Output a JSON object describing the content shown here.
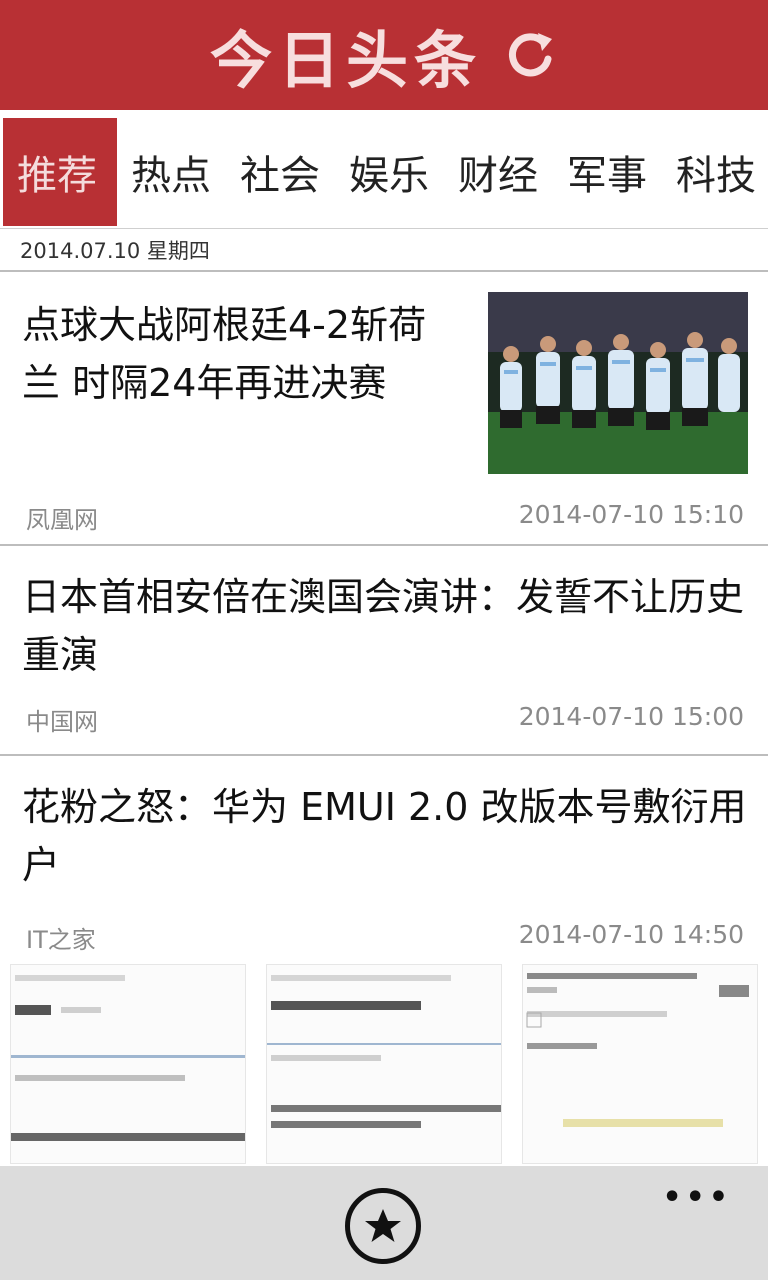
{
  "header": {
    "logo_text": "今日头条",
    "refresh_icon": "refresh-icon"
  },
  "tabs": [
    {
      "label": "推荐",
      "active": true
    },
    {
      "label": "热点"
    },
    {
      "label": "社会"
    },
    {
      "label": "娱乐"
    },
    {
      "label": "财经"
    },
    {
      "label": "军事"
    },
    {
      "label": "科技"
    }
  ],
  "date_line": "2014.07.10 星期四",
  "articles": [
    {
      "title": "点球大战阿根廷4-2斩荷兰 时隔24年再进决赛",
      "source": "凤凰网",
      "time": "2014-07-10 15:10"
    },
    {
      "title": "日本首相安倍在澳国会演讲：发誓不让历史重演",
      "source": "中国网",
      "time": "2014-07-10 15:00"
    },
    {
      "title": "花粉之怒：华为 EMUI 2.0 改版本号敷衍用户",
      "source": "IT之家",
      "time": "2014-07-10 14:50"
    }
  ],
  "appbar": {
    "favorite_icon": "star-icon",
    "more_label": "•••"
  },
  "colors": {
    "brand_red": "#b83034",
    "appbar_bg": "#dcdcdc"
  }
}
